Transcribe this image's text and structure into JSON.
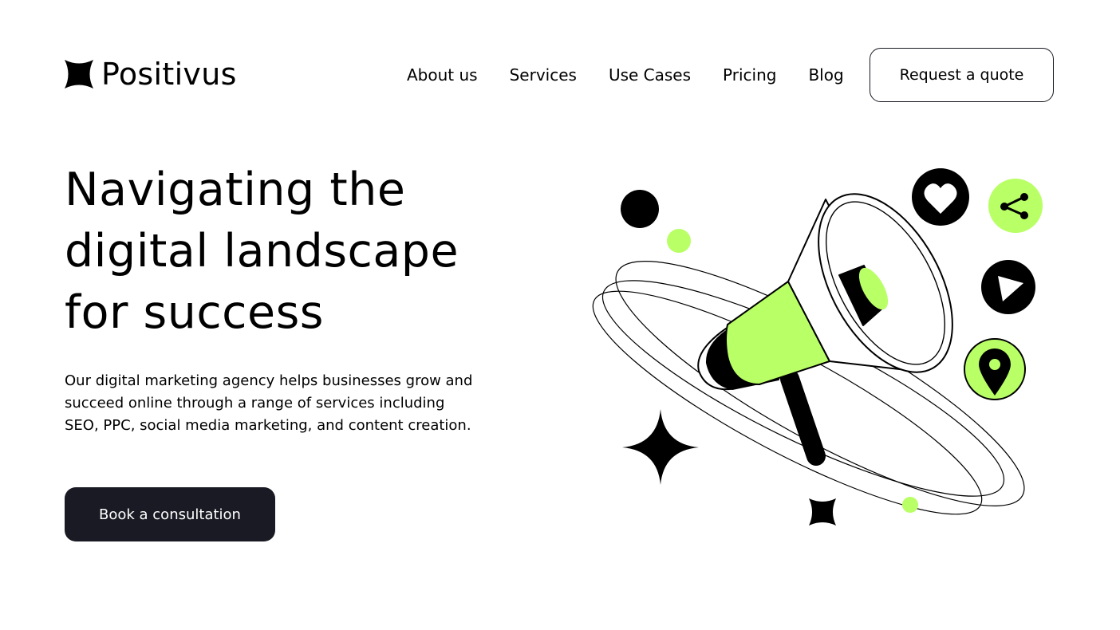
{
  "brand": {
    "name": "Positivus",
    "logo_icon": "four-point-star-icon"
  },
  "nav": {
    "items": [
      {
        "label": "About us"
      },
      {
        "label": "Services"
      },
      {
        "label": "Use Cases"
      },
      {
        "label": "Pricing"
      },
      {
        "label": "Blog"
      }
    ],
    "cta_label": "Request a quote"
  },
  "hero": {
    "title": "Navigating the digital landscape for success",
    "description": "Our digital marketing agency helps businesses grow and succeed online through a range of services including SEO, PPC, social media marketing, and content creation.",
    "cta_label": "Book a consultation"
  },
  "illustration": {
    "main": "megaphone-icon",
    "badges": [
      "heart-icon",
      "share-icon",
      "play-icon",
      "location-pin-icon"
    ]
  },
  "colors": {
    "accent": "#B9FF66",
    "dark": "#191A23",
    "background": "#FFFFFF"
  }
}
